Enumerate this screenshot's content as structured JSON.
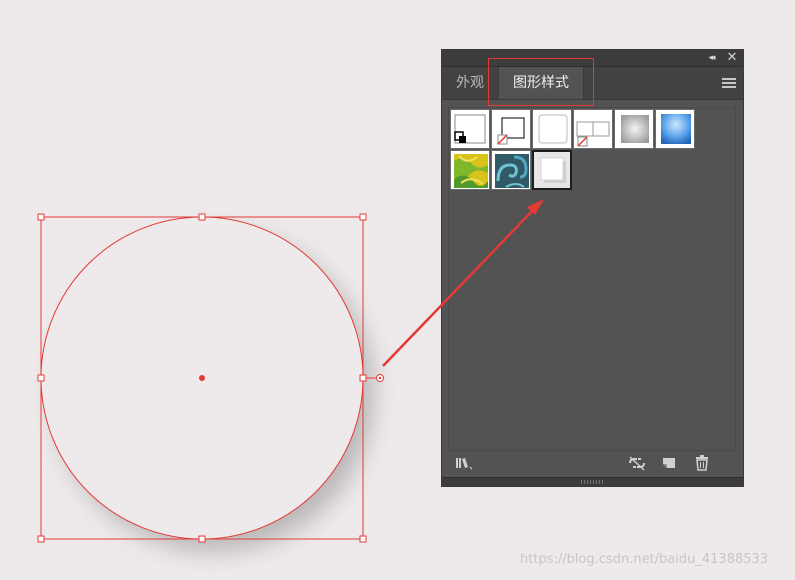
{
  "panel": {
    "collapse_glyph": "◂◂",
    "close_glyph": "✕",
    "tabs": [
      {
        "label": "外观",
        "active": false
      },
      {
        "label": "图形样式",
        "active": true
      }
    ],
    "menu_icon": "hamburger-menu-icon",
    "swatches": [
      {
        "name": "default-style",
        "icon": "default-graphic-style-swatch"
      },
      {
        "name": "no-fill-basic-stroke",
        "icon": "basic-stroke-swatch"
      },
      {
        "name": "rounded-square",
        "icon": "rounded-swatch"
      },
      {
        "name": "split-square",
        "icon": "split-swatch"
      },
      {
        "name": "soft-gray-gradient",
        "icon": "gray-gradient-swatch"
      },
      {
        "name": "blue-glow",
        "icon": "blue-glow-swatch"
      },
      {
        "name": "yellow-green-pattern",
        "icon": "pattern-swatch"
      },
      {
        "name": "teal-swirl-pattern",
        "icon": "swirl-pattern-swatch"
      },
      {
        "name": "drop-shadow-new",
        "icon": "drop-shadow-swatch",
        "selected": true
      }
    ],
    "bottom_icons": [
      "graphic-styles-library-icon",
      "break-link-icon",
      "new-style-icon",
      "trash-icon"
    ]
  },
  "colors": {
    "selection": "#e53935",
    "panel_bg": "#535353",
    "canvas_bg": "#eeeaeb"
  },
  "watermark": "https://blog.csdn.net/baidu_41388533"
}
